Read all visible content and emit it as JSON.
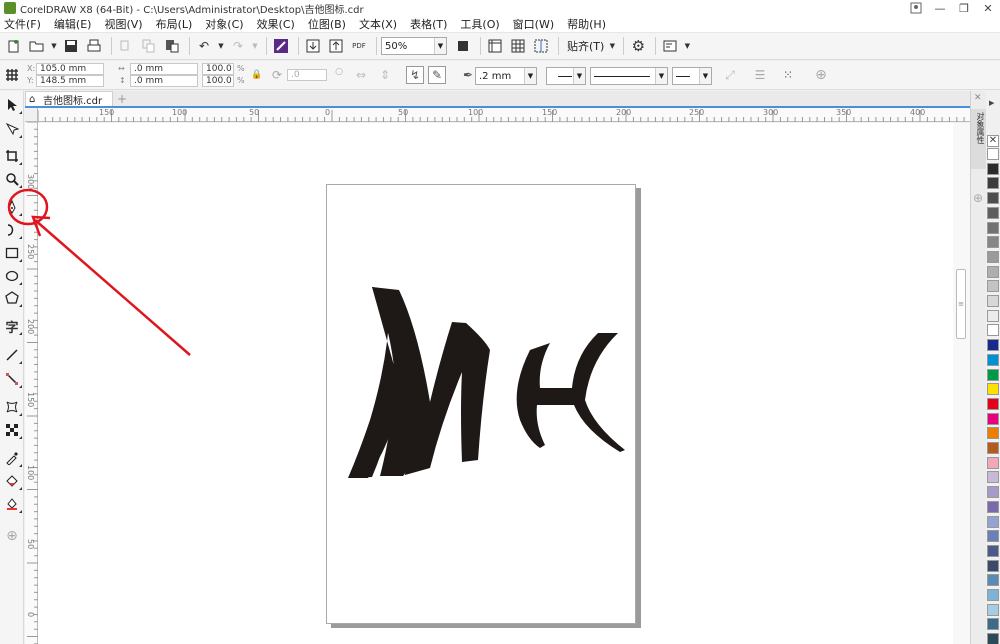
{
  "window": {
    "title": "CorelDRAW X8 (64-Bit) - C:\\Users\\Administrator\\Desktop\\吉他图标.cdr",
    "minimize_glyph": "□",
    "restore_glyph": "❐",
    "close_glyph": "✕"
  },
  "menu": [
    "文件(F)",
    "编辑(E)",
    "视图(V)",
    "布局(L)",
    "对象(C)",
    "效果(C)",
    "位图(B)",
    "文本(X)",
    "表格(T)",
    "工具(O)",
    "窗口(W)",
    "帮助(H)"
  ],
  "standard_toolbar": {
    "zoom_value": "50%",
    "snap_label": "贴齐(T)",
    "pdf_label": "PDF"
  },
  "property_bar": {
    "x": "105.0 mm",
    "y": "148.5 mm",
    "width": ".0 mm",
    "height": ".0 mm",
    "scale_x": "100.0",
    "scale_y": "100.0",
    "percent": "%",
    "rotation": ".0",
    "outline_width": ".2 mm"
  },
  "document": {
    "tab_label": "吉他图标.cdr",
    "tab_close": "×",
    "add_tab": "+"
  },
  "ruler": {
    "h_labels": [
      "150",
      "100",
      "50",
      "0",
      "50",
      "100",
      "150",
      "200",
      "250",
      "300",
      "350",
      "400"
    ],
    "v_labels": [
      "300",
      "250",
      "200",
      "150",
      "100",
      "50",
      "0"
    ]
  },
  "docker": {
    "tab_label": "对象属性"
  },
  "drawing": {
    "letters": "MK",
    "fill": "#1e1916"
  },
  "annotation": {
    "color": "#e0161e"
  },
  "palette": [
    "#ffffff",
    "#2b2b2b",
    "#3c3c3c",
    "#4d4d4d",
    "#5e5e5e",
    "#727272",
    "#868686",
    "#9a9a9a",
    "#aeaeae",
    "#c3c3c3",
    "#d7d7d7",
    "#ebebeb",
    "#ffffff",
    "#1a2a8c",
    "#0091d5",
    "#009a44",
    "#ffe100",
    "#e2001a",
    "#e6007e",
    "#ee7d00",
    "#b45a1e",
    "#f4a7b9",
    "#c8b9d8",
    "#a59ac9",
    "#7a6aac",
    "#93a3d3",
    "#6a7fb7",
    "#4a5a8a",
    "#3a4a6a",
    "#5a8ab5",
    "#7fb3d5",
    "#a6cee3",
    "#3b6a8a",
    "#2a4a5a",
    "#4a6a7a",
    "#6a8a9a"
  ]
}
